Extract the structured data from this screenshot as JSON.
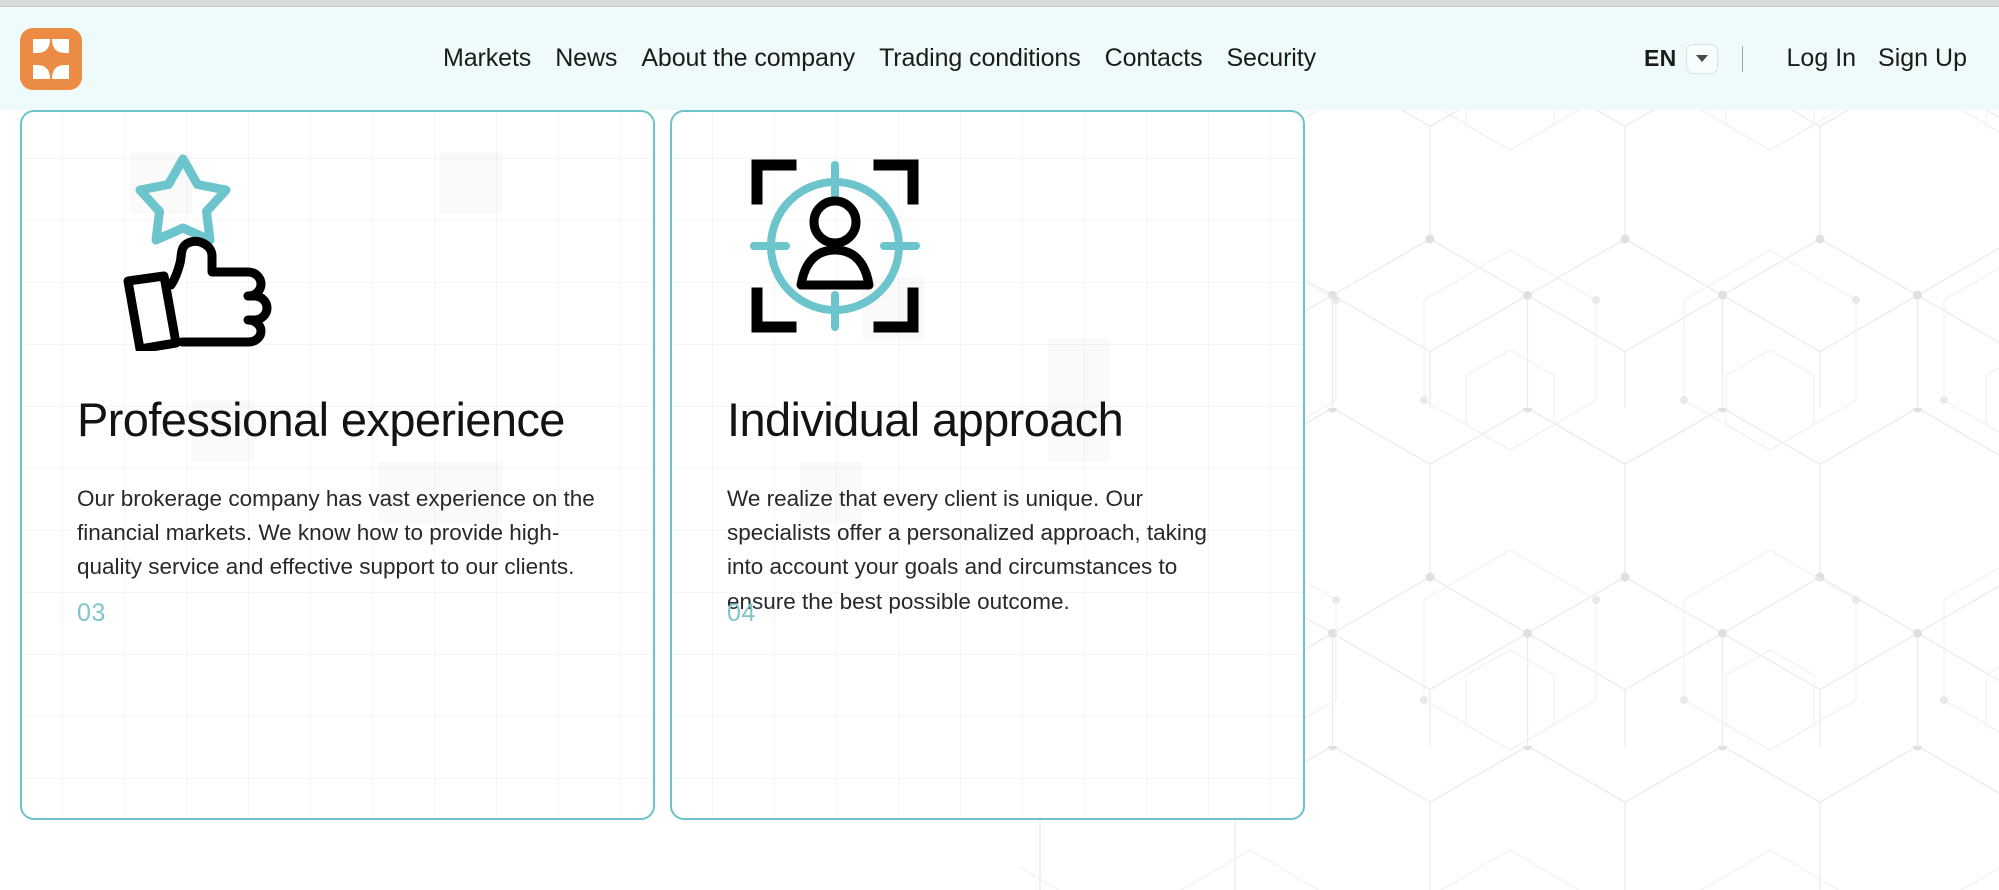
{
  "brand": {
    "logo_icon": "butterfly-x-logo-icon",
    "logo_color": "#ec8b43"
  },
  "header": {
    "background_color": "#effbfa",
    "nav": [
      {
        "label": "Markets",
        "name": "nav-item-markets"
      },
      {
        "label": "News",
        "name": "nav-item-news"
      },
      {
        "label": "About the company",
        "name": "nav-item-about-the-company"
      },
      {
        "label": "Trading conditions",
        "name": "nav-item-trading-conditions"
      },
      {
        "label": "Contacts",
        "name": "nav-item-contacts"
      },
      {
        "label": "Security",
        "name": "nav-item-security"
      }
    ],
    "language": {
      "code": "EN",
      "caret_icon": "chevron-down-icon"
    },
    "separator": "|",
    "log_in_label": "Log In",
    "sign_up_label": "Sign Up"
  },
  "cards": [
    {
      "number": "03",
      "title": "Professional experience",
      "body": "Our brokerage company has vast experience on the financial markets. We know how to provide high-quality service and effective support to our clients.",
      "icons": [
        "star-icon",
        "thumbs-up-icon"
      ],
      "border_color": "#6cc4c8",
      "number_color": "#7fc6cb"
    },
    {
      "number": "04",
      "title": "Individual approach",
      "body": "We realize that every client is unique. Our specialists offer a personalized approach, taking into account your goals and circumstances to ensure the best possible outcome.",
      "icons": [
        "focus-frame-icon",
        "crosshair-circle-icon",
        "person-icon"
      ],
      "border_color": "#6cc4c8",
      "number_color": "#7fc6cb"
    }
  ],
  "background": {
    "pattern": "hexagon-network-pattern",
    "line_color": "#e8eaea",
    "dot_color": "#dcdede"
  }
}
